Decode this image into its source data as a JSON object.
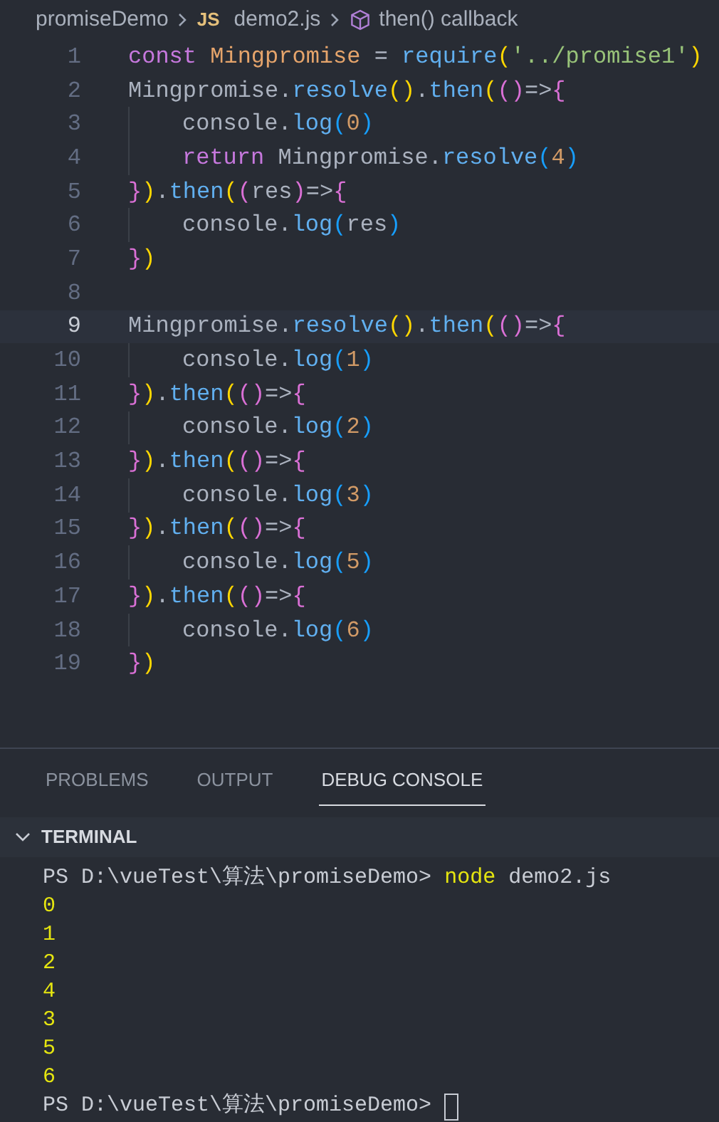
{
  "breadcrumb": {
    "folder": "promiseDemo",
    "file_badge": "JS",
    "file": "demo2.js",
    "symbol": "then() callback"
  },
  "editor": {
    "lines": [
      {
        "number": "1",
        "current": false,
        "indent": false,
        "tokens": [
          {
            "text": "const ",
            "kind": "keyword"
          },
          {
            "text": "Mingpromise",
            "kind": "decl"
          },
          {
            "text": " = ",
            "kind": "plain"
          },
          {
            "text": "require",
            "kind": "fn"
          },
          {
            "text": "(",
            "kind": "b1"
          },
          {
            "text": "'../promise1'",
            "kind": "str"
          },
          {
            "text": ")",
            "kind": "b1"
          }
        ]
      },
      {
        "number": "2",
        "current": false,
        "indent": false,
        "tokens": [
          {
            "text": "Mingpromise.",
            "kind": "plain"
          },
          {
            "text": "resolve",
            "kind": "fn"
          },
          {
            "text": "()",
            "kind": "b1"
          },
          {
            "text": ".",
            "kind": "plain"
          },
          {
            "text": "then",
            "kind": "fn"
          },
          {
            "text": "(",
            "kind": "b1"
          },
          {
            "text": "()",
            "kind": "b2"
          },
          {
            "text": "=>",
            "kind": "plain"
          },
          {
            "text": "{",
            "kind": "b2"
          }
        ]
      },
      {
        "number": "3",
        "current": false,
        "indent": true,
        "tokens": [
          {
            "text": "console.",
            "kind": "plain"
          },
          {
            "text": "log",
            "kind": "fn"
          },
          {
            "text": "(",
            "kind": "b3"
          },
          {
            "text": "0",
            "kind": "num"
          },
          {
            "text": ")",
            "kind": "b3"
          }
        ]
      },
      {
        "number": "4",
        "current": false,
        "indent": true,
        "tokens": [
          {
            "text": "return ",
            "kind": "keyword"
          },
          {
            "text": "Mingpromise.",
            "kind": "plain"
          },
          {
            "text": "resolve",
            "kind": "fn"
          },
          {
            "text": "(",
            "kind": "b3"
          },
          {
            "text": "4",
            "kind": "num"
          },
          {
            "text": ")",
            "kind": "b3"
          }
        ]
      },
      {
        "number": "5",
        "current": false,
        "indent": false,
        "tokens": [
          {
            "text": "}",
            "kind": "b2"
          },
          {
            "text": ")",
            "kind": "b1"
          },
          {
            "text": ".",
            "kind": "plain"
          },
          {
            "text": "then",
            "kind": "fn"
          },
          {
            "text": "(",
            "kind": "b1"
          },
          {
            "text": "(",
            "kind": "b2"
          },
          {
            "text": "res",
            "kind": "plain"
          },
          {
            "text": ")",
            "kind": "b2"
          },
          {
            "text": "=>",
            "kind": "plain"
          },
          {
            "text": "{",
            "kind": "b2"
          }
        ]
      },
      {
        "number": "6",
        "current": false,
        "indent": true,
        "tokens": [
          {
            "text": "console.",
            "kind": "plain"
          },
          {
            "text": "log",
            "kind": "fn"
          },
          {
            "text": "(",
            "kind": "b3"
          },
          {
            "text": "res",
            "kind": "plain"
          },
          {
            "text": ")",
            "kind": "b3"
          }
        ]
      },
      {
        "number": "7",
        "current": false,
        "indent": false,
        "tokens": [
          {
            "text": "}",
            "kind": "b2"
          },
          {
            "text": ")",
            "kind": "b1"
          }
        ]
      },
      {
        "number": "8",
        "current": false,
        "indent": false
      },
      {
        "number": "9",
        "current": true,
        "indent": false,
        "tokens": [
          {
            "text": "Mingpromise.",
            "kind": "plain"
          },
          {
            "text": "resolve",
            "kind": "fn"
          },
          {
            "text": "()",
            "kind": "b1"
          },
          {
            "text": ".",
            "kind": "plain"
          },
          {
            "text": "then",
            "kind": "fn"
          },
          {
            "text": "(",
            "kind": "b1"
          },
          {
            "text": "()",
            "kind": "b2"
          },
          {
            "text": "=>",
            "kind": "plain"
          },
          {
            "text": "{",
            "kind": "b2"
          }
        ]
      },
      {
        "number": "10",
        "current": false,
        "indent": true,
        "tokens": [
          {
            "text": "console.",
            "kind": "plain"
          },
          {
            "text": "log",
            "kind": "fn"
          },
          {
            "text": "(",
            "kind": "b3"
          },
          {
            "text": "1",
            "kind": "num"
          },
          {
            "text": ")",
            "kind": "b3"
          }
        ]
      },
      {
        "number": "11",
        "current": false,
        "indent": false,
        "tokens": [
          {
            "text": "}",
            "kind": "b2"
          },
          {
            "text": ")",
            "kind": "b1"
          },
          {
            "text": ".",
            "kind": "plain"
          },
          {
            "text": "then",
            "kind": "fn"
          },
          {
            "text": "(",
            "kind": "b1"
          },
          {
            "text": "()",
            "kind": "b2"
          },
          {
            "text": "=>",
            "kind": "plain"
          },
          {
            "text": "{",
            "kind": "b2"
          }
        ]
      },
      {
        "number": "12",
        "current": false,
        "indent": true,
        "tokens": [
          {
            "text": "console.",
            "kind": "plain"
          },
          {
            "text": "log",
            "kind": "fn"
          },
          {
            "text": "(",
            "kind": "b3"
          },
          {
            "text": "2",
            "kind": "num"
          },
          {
            "text": ")",
            "kind": "b3"
          }
        ]
      },
      {
        "number": "13",
        "current": false,
        "indent": false,
        "tokens": [
          {
            "text": "}",
            "kind": "b2"
          },
          {
            "text": ")",
            "kind": "b1"
          },
          {
            "text": ".",
            "kind": "plain"
          },
          {
            "text": "then",
            "kind": "fn"
          },
          {
            "text": "(",
            "kind": "b1"
          },
          {
            "text": "()",
            "kind": "b2"
          },
          {
            "text": "=>",
            "kind": "plain"
          },
          {
            "text": "{",
            "kind": "b2"
          }
        ]
      },
      {
        "number": "14",
        "current": false,
        "indent": true,
        "tokens": [
          {
            "text": "console.",
            "kind": "plain"
          },
          {
            "text": "log",
            "kind": "fn"
          },
          {
            "text": "(",
            "kind": "b3"
          },
          {
            "text": "3",
            "kind": "num"
          },
          {
            "text": ")",
            "kind": "b3"
          }
        ]
      },
      {
        "number": "15",
        "current": false,
        "indent": false,
        "tokens": [
          {
            "text": "}",
            "kind": "b2"
          },
          {
            "text": ")",
            "kind": "b1"
          },
          {
            "text": ".",
            "kind": "plain"
          },
          {
            "text": "then",
            "kind": "fn"
          },
          {
            "text": "(",
            "kind": "b1"
          },
          {
            "text": "()",
            "kind": "b2"
          },
          {
            "text": "=>",
            "kind": "plain"
          },
          {
            "text": "{",
            "kind": "b2"
          }
        ]
      },
      {
        "number": "16",
        "current": false,
        "indent": true,
        "tokens": [
          {
            "text": "console.",
            "kind": "plain"
          },
          {
            "text": "log",
            "kind": "fn"
          },
          {
            "text": "(",
            "kind": "b3"
          },
          {
            "text": "5",
            "kind": "num"
          },
          {
            "text": ")",
            "kind": "b3"
          }
        ]
      },
      {
        "number": "17",
        "current": false,
        "indent": false,
        "tokens": [
          {
            "text": "}",
            "kind": "b2"
          },
          {
            "text": ")",
            "kind": "b1"
          },
          {
            "text": ".",
            "kind": "plain"
          },
          {
            "text": "then",
            "kind": "fn"
          },
          {
            "text": "(",
            "kind": "b1"
          },
          {
            "text": "()",
            "kind": "b2"
          },
          {
            "text": "=>",
            "kind": "plain"
          },
          {
            "text": "{",
            "kind": "b2"
          }
        ]
      },
      {
        "number": "18",
        "current": false,
        "indent": true,
        "tokens": [
          {
            "text": "console.",
            "kind": "plain"
          },
          {
            "text": "log",
            "kind": "fn"
          },
          {
            "text": "(",
            "kind": "b3"
          },
          {
            "text": "6",
            "kind": "num"
          },
          {
            "text": ")",
            "kind": "b3"
          }
        ]
      },
      {
        "number": "19",
        "current": false,
        "indent": false,
        "tokens": [
          {
            "text": "}",
            "kind": "b2"
          },
          {
            "text": ")",
            "kind": "b1"
          }
        ]
      }
    ]
  },
  "panel": {
    "tabs": [
      {
        "label": "PROBLEMS",
        "selected": false
      },
      {
        "label": "OUTPUT",
        "selected": false
      },
      {
        "label": "DEBUG CONSOLE",
        "selected": true
      }
    ],
    "terminal": {
      "title": "TERMINAL",
      "expanded": true,
      "lines": [
        {
          "kind": "command",
          "prompt": "PS D:\\vueTest\\算法\\promiseDemo>",
          "command": "node",
          "args": "demo2.js"
        },
        {
          "kind": "output",
          "text": "0"
        },
        {
          "kind": "output",
          "text": "1"
        },
        {
          "kind": "output",
          "text": "2"
        },
        {
          "kind": "output",
          "text": "4"
        },
        {
          "kind": "output",
          "text": "3"
        },
        {
          "kind": "output",
          "text": "5"
        },
        {
          "kind": "output",
          "text": "6"
        },
        {
          "kind": "prompt",
          "prompt": "PS D:\\vueTest\\算法\\promiseDemo>"
        }
      ]
    }
  }
}
